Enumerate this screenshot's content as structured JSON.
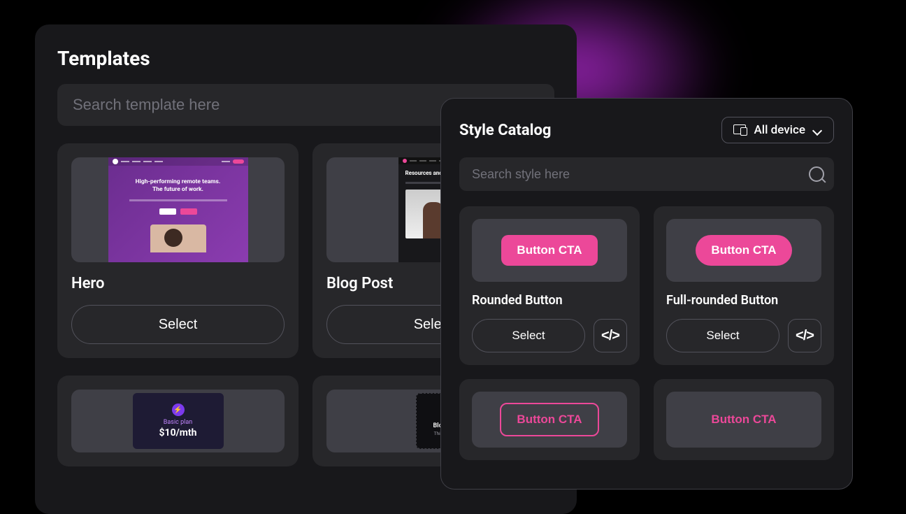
{
  "templates": {
    "title": "Templates",
    "search_placeholder": "Search template here",
    "select_label": "Select",
    "cards": [
      {
        "title": "Hero",
        "mock": {
          "headline_1": "High-performing remote teams.",
          "headline_2": "The future of work."
        }
      },
      {
        "title": "Blog Post",
        "mock": {
          "headline": "Resources and insights"
        }
      }
    ],
    "cards_row2": {
      "pricing": {
        "plan": "Basic plan",
        "price": "$10/mth"
      },
      "publish": {
        "title": "Blog post published",
        "sub": "This blog post has been pu"
      }
    }
  },
  "catalog": {
    "title": "Style Catalog",
    "device_label": "All device",
    "search_placeholder": "Search style here",
    "cta_label": "Button CTA",
    "select_label": "Select",
    "styles": [
      {
        "name": "Rounded Button",
        "variant": "rounded"
      },
      {
        "name": "Full-rounded Button",
        "variant": "full"
      }
    ],
    "styles_row2": [
      {
        "variant": "outline"
      },
      {
        "variant": "text"
      }
    ]
  }
}
